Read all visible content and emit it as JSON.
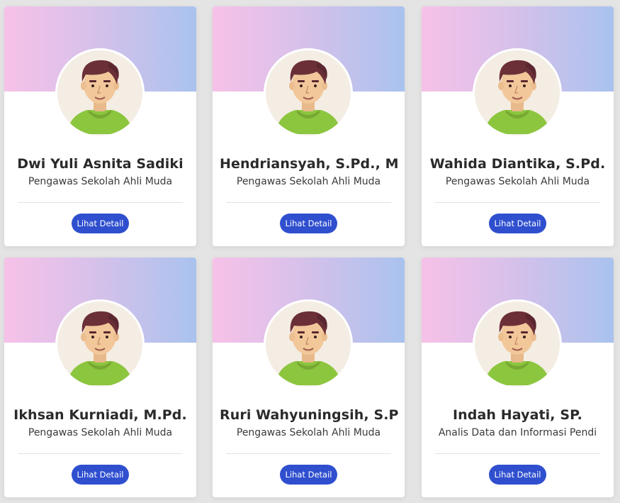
{
  "staff": [
    {
      "name": "Dwi Yuli Asnita Sadiki",
      "role": "Pengawas Sekolah Ahli Muda",
      "button": "Lihat Detail"
    },
    {
      "name": "Hendriansyah, S.Pd., M",
      "role": "Pengawas Sekolah Ahli Muda",
      "button": "Lihat Detail"
    },
    {
      "name": "Wahida Diantika, S.Pd.",
      "role": "Pengawas Sekolah Ahli Muda",
      "button": "Lihat Detail"
    },
    {
      "name": "Ikhsan Kurniadi, M.Pd.",
      "role": "Pengawas Sekolah Ahli Muda",
      "button": "Lihat Detail"
    },
    {
      "name": "Ruri Wahyuningsih, S.P",
      "role": "Pengawas Sekolah Ahli Muda",
      "button": "Lihat Detail"
    },
    {
      "name": "Indah Hayati, SP.",
      "role": "Analis Data dan Informasi Pendi",
      "button": "Lihat Detail"
    }
  ],
  "avatar_icon": "default-male-avatar-icon",
  "colors": {
    "banner_gradient": [
      "#f7c1e8",
      "#d8c1ea",
      "#a9c2ee"
    ],
    "button": "#2f4fcf",
    "shirt": "#8cc63f",
    "hair": "#6b2f37",
    "skin": "#f2c89b"
  }
}
